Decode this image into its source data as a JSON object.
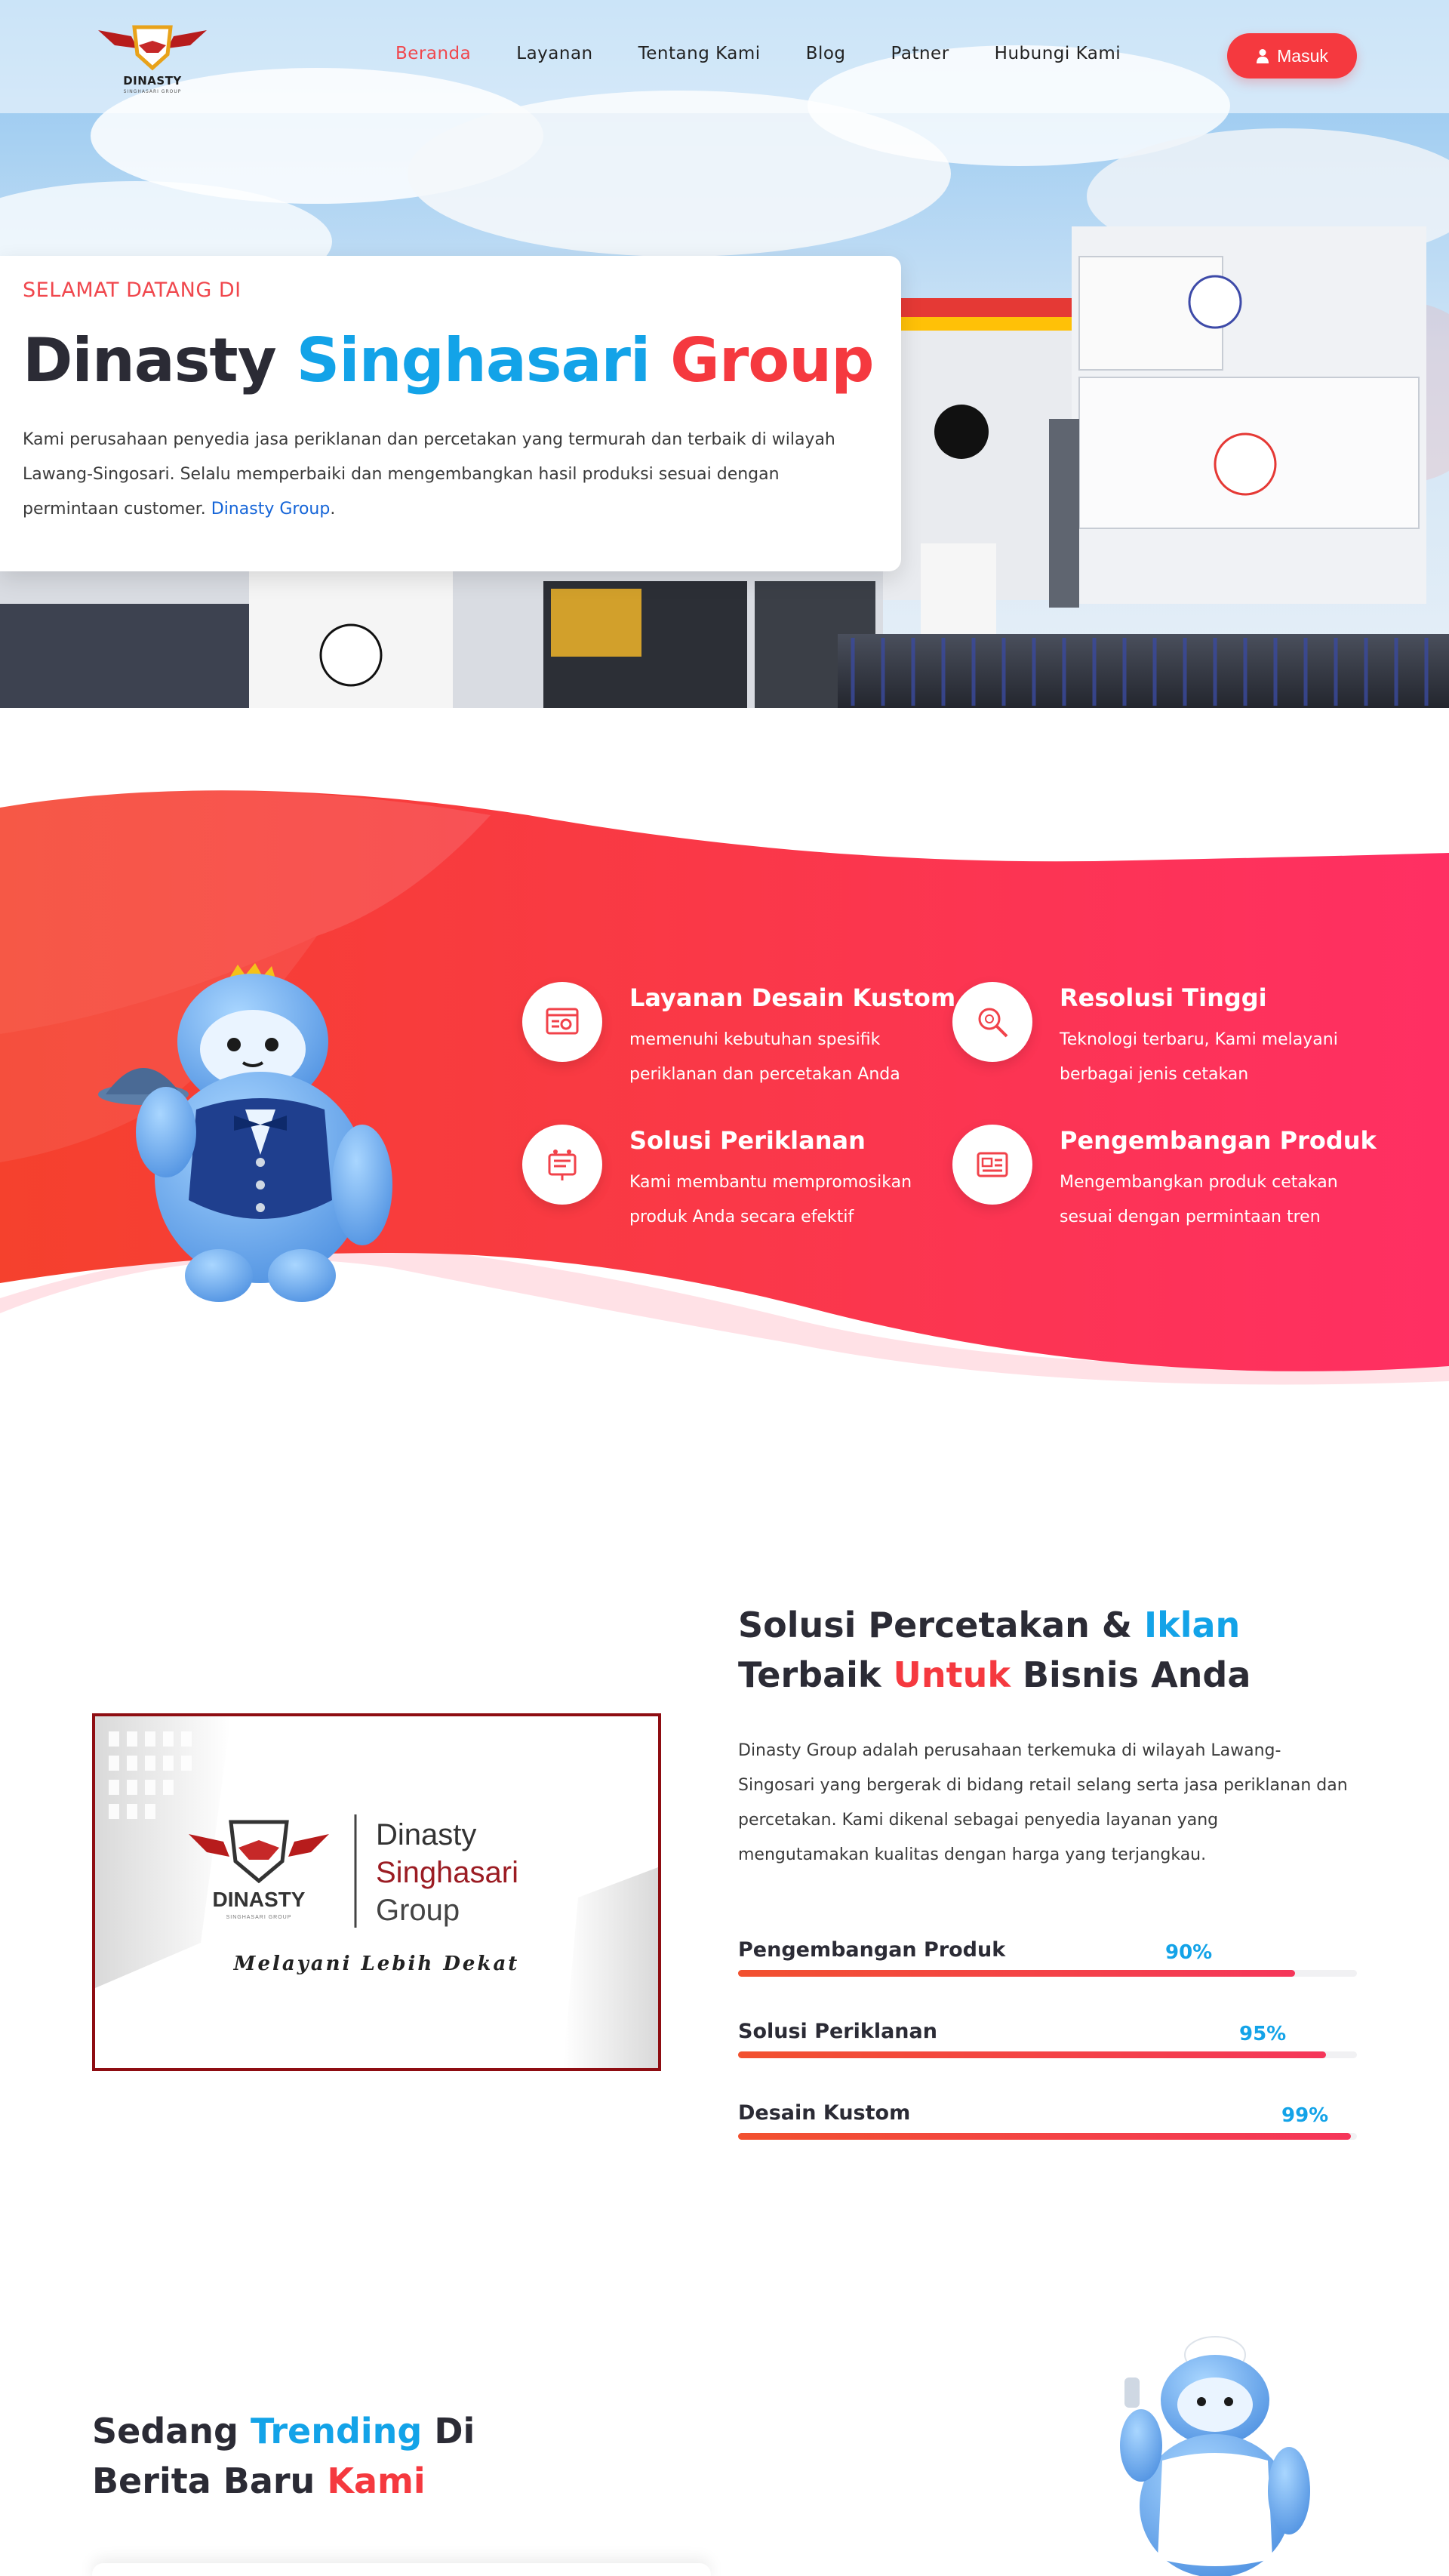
{
  "brand": {
    "logo_text": "DINASTY",
    "logo_sub": "SINGHASARI GROUP"
  },
  "nav": {
    "items": [
      {
        "label": "Beranda",
        "active": true
      },
      {
        "label": "Layanan",
        "active": false
      },
      {
        "label": "Tentang Kami",
        "active": false
      },
      {
        "label": "Blog",
        "active": false
      },
      {
        "label": "Patner",
        "active": false
      },
      {
        "label": "Hubungi Kami",
        "active": false
      }
    ],
    "login_label": "Masuk",
    "login_icon": "user-icon"
  },
  "hero": {
    "kicker": "SELAMAT DATANG DI",
    "title_part1": "Dinasty",
    "title_part2": "Singhasari",
    "title_part3": "Group",
    "description": "Kami perusahaan penyedia jasa periklanan dan percetakan yang termurah dan terbaik di wilayah Lawang-Singosari. Selalu memperbaiki dan mengembangkan hasil produksi sesuai dengan permintaan customer.",
    "description_link": "Dinasty Group",
    "description_end": "."
  },
  "features": [
    {
      "title": "Layanan Desain Kustom",
      "desc": "memenuhi kebutuhan spesifik periklanan dan percetakan Anda",
      "icon": "design-icon"
    },
    {
      "title": "Resolusi Tinggi",
      "desc": "Teknologi terbaru, Kami melayani berbagai jenis cetakan",
      "icon": "magnifier-icon"
    },
    {
      "title": "Solusi Periklanan",
      "desc": "Kami membantu mempromosikan produk Anda secara efektif",
      "icon": "ads-icon"
    },
    {
      "title": "Pengembangan Produk",
      "desc": "Mengembangkan produk cetakan sesuai dengan permintaan tren",
      "icon": "product-icon"
    }
  ],
  "about": {
    "title_a": "Solusi Percetakan & ",
    "title_b": "Iklan",
    "title_c": "Terbaik ",
    "title_d": "Untuk",
    "title_e": " Bisnis Anda",
    "description": "Dinasty Group adalah perusahaan terkemuka di wilayah Lawang-Singosari yang bergerak di bidang retail selang serta jasa periklanan dan percetakan. Kami dikenal sebagai penyedia layanan yang mengutamakan kualitas dengan harga yang terjangkau.",
    "image_brand": "DINASTY",
    "image_brand_sub": "SINGHASARI GROUP",
    "image_line1": "Dinasty",
    "image_line2": "Singhasari",
    "image_line3": "Group",
    "image_tagline": "Melayani Lebih Dekat",
    "skills": [
      {
        "label": "Pengembangan Produk",
        "percent_label": "90%",
        "value": 0.9
      },
      {
        "label": "Solusi Periklanan",
        "percent_label": "95%",
        "value": 0.95
      },
      {
        "label": "Desain Kustom",
        "percent_label": "99%",
        "value": 0.99
      }
    ]
  },
  "trending": {
    "line1_a": "Sedang ",
    "line1_b": "Trending",
    "line1_c": " Di",
    "line2_a": "Berita Baru ",
    "line2_b": "Kami"
  },
  "colors": {
    "accent_red": "#f5393f",
    "accent_blue": "#13a3e8",
    "heading": "#2b2b35"
  }
}
